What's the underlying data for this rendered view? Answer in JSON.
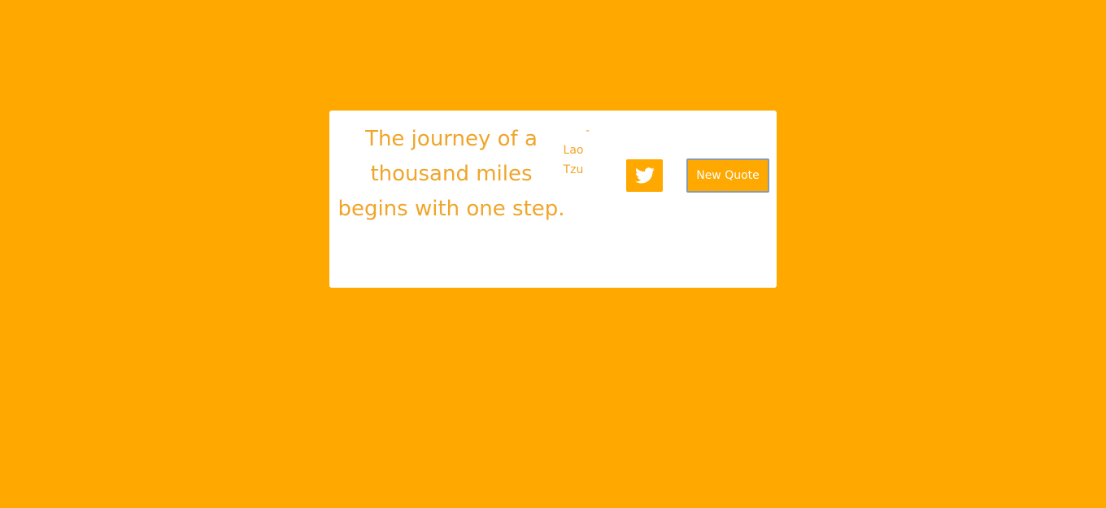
{
  "quote": {
    "text": "The journey of a thousand miles begins with one step.",
    "dash": "-",
    "author": "Lao Tzu"
  },
  "actions": {
    "tweet_icon": "twitter-icon",
    "new_quote_label": "New Quote"
  },
  "colors": {
    "background": "#FFA800",
    "card": "#FFFFFF",
    "quote_text": "#F0A52A",
    "button": "#FFA800",
    "button_text": "#FFFFFF",
    "button_border": "#8A9BB0"
  }
}
